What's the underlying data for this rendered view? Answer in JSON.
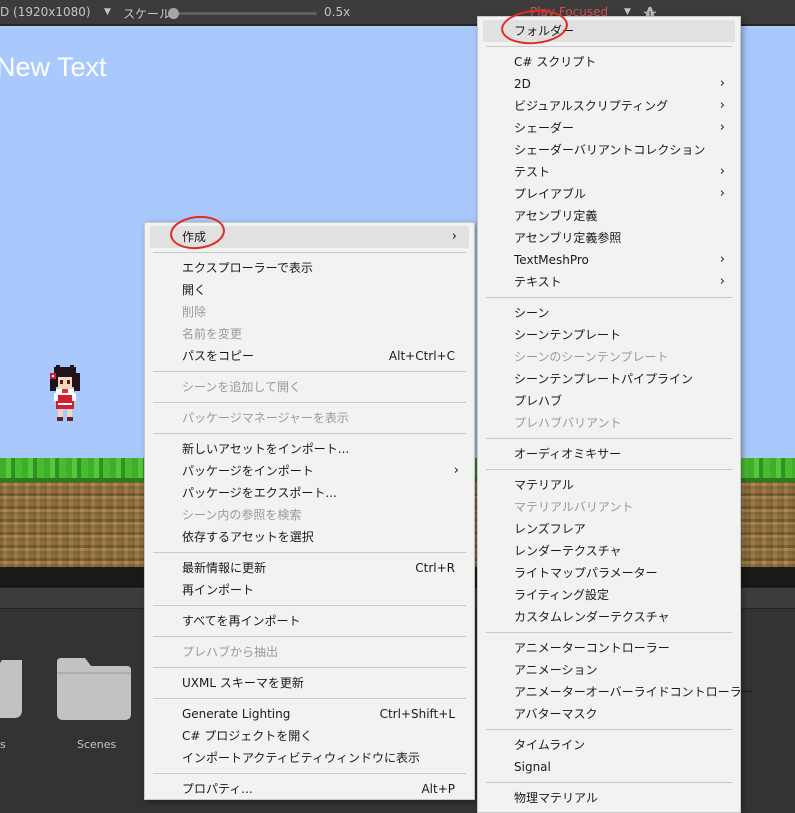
{
  "toolbar": {
    "resolution": "D (1920x1080)",
    "dropdown_arrow": "▼",
    "scale_label": "スケール",
    "scale_value": "0.5x",
    "scale_level": 0.0,
    "play_mode": "Play Focused",
    "play_arrow": "▼"
  },
  "scene": {
    "text": "New Text"
  },
  "project": {
    "folders": [
      {
        "label": "s"
      },
      {
        "label": "Scenes"
      }
    ]
  },
  "colors": {
    "sky": "#a9c9fd",
    "menu_bg": "#f2f2f2",
    "highlight_circle": "#e32a1c"
  },
  "left_menu": {
    "items": [
      {
        "label": "作成",
        "arrow": "›",
        "highlighted": true
      },
      {
        "separator": true
      },
      {
        "label": "エクスプローラーで表示"
      },
      {
        "label": "開く"
      },
      {
        "label": "削除",
        "disabled": true
      },
      {
        "label": "名前を変更",
        "disabled": true
      },
      {
        "label": "パスをコピー",
        "shortcut": "Alt+Ctrl+C"
      },
      {
        "separator": true
      },
      {
        "label": "シーンを追加して開く",
        "disabled": true
      },
      {
        "separator": true
      },
      {
        "label": "パッケージマネージャーを表示",
        "disabled": true
      },
      {
        "separator": true
      },
      {
        "label": "新しいアセットをインポート..."
      },
      {
        "label": "パッケージをインポート",
        "arrow": "›"
      },
      {
        "label": "パッケージをエクスポート..."
      },
      {
        "label": "シーン内の参照を検索",
        "disabled": true
      },
      {
        "label": "依存するアセットを選択"
      },
      {
        "separator": true
      },
      {
        "label": "最新情報に更新",
        "shortcut": "Ctrl+R"
      },
      {
        "label": "再インポート"
      },
      {
        "separator": true
      },
      {
        "label": "すべてを再インポート"
      },
      {
        "separator": true
      },
      {
        "label": "プレハブから抽出",
        "disabled": true
      },
      {
        "separator": true
      },
      {
        "label": "UXML スキーマを更新"
      },
      {
        "separator": true
      },
      {
        "label": "Generate Lighting",
        "shortcut": "Ctrl+Shift+L"
      },
      {
        "label": "C# プロジェクトを開く"
      },
      {
        "label": "インポートアクティビティウィンドウに表示"
      },
      {
        "separator": true
      },
      {
        "label": "プロパティ...",
        "shortcut": "Alt+P"
      }
    ]
  },
  "right_menu": {
    "items": [
      {
        "label": "フォルダー",
        "highlighted": true
      },
      {
        "separator": true
      },
      {
        "label": "C# スクリプト"
      },
      {
        "label": "2D",
        "arrow": "›"
      },
      {
        "label": "ビジュアルスクリプティング",
        "arrow": "›"
      },
      {
        "label": "シェーダー",
        "arrow": "›"
      },
      {
        "label": "シェーダーバリアントコレクション"
      },
      {
        "label": "テスト",
        "arrow": "›"
      },
      {
        "label": "プレイアブル",
        "arrow": "›"
      },
      {
        "label": "アセンブリ定義"
      },
      {
        "label": "アセンブリ定義参照"
      },
      {
        "label": "TextMeshPro",
        "arrow": "›"
      },
      {
        "label": "テキスト",
        "arrow": "›"
      },
      {
        "separator": true
      },
      {
        "label": "シーン"
      },
      {
        "label": "シーンテンプレート"
      },
      {
        "label": "シーンのシーンテンプレート",
        "disabled": true
      },
      {
        "label": "シーンテンプレートパイプライン"
      },
      {
        "label": "プレハブ"
      },
      {
        "label": "プレハブバリアント",
        "disabled": true
      },
      {
        "separator": true
      },
      {
        "label": "オーディオミキサー"
      },
      {
        "separator": true
      },
      {
        "label": "マテリアル"
      },
      {
        "label": "マテリアルバリアント",
        "disabled": true
      },
      {
        "label": "レンズフレア"
      },
      {
        "label": "レンダーテクスチャ"
      },
      {
        "label": "ライトマップパラメーター"
      },
      {
        "label": "ライティング設定"
      },
      {
        "label": "カスタムレンダーテクスチャ"
      },
      {
        "separator": true
      },
      {
        "label": "アニメーターコントローラー"
      },
      {
        "label": "アニメーション"
      },
      {
        "label": "アニメーターオーバーライドコントローラー"
      },
      {
        "label": "アバターマスク"
      },
      {
        "separator": true
      },
      {
        "label": "タイムライン"
      },
      {
        "label": "Signal"
      },
      {
        "separator": true
      },
      {
        "label": "物理マテリアル"
      }
    ]
  }
}
